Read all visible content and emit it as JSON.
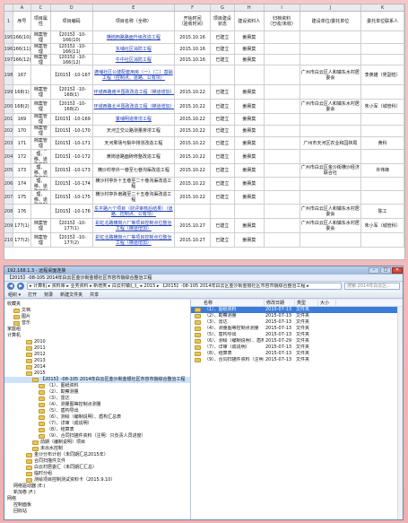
{
  "sheet": {
    "col_letters": [
      "",
      "A",
      "C",
      "D",
      "E",
      "F",
      "G",
      "H",
      "I",
      "J",
      "K"
    ],
    "header": {
      "row_label": "1",
      "no": "序号",
      "type": "项目属性",
      "code": "项目编码",
      "name": "项目名称（全称）",
      "opened": "开始时间",
      "opened_sub": "（验收时间）",
      "status": "项目建设状态",
      "dept": "建设资料人",
      "archive": "归档资料",
      "archive_sub": "（已收/未收）",
      "unit": "建设单位/委托单位",
      "contact": "委托单位联系人"
    },
    "rows": [
      {
        "rn": "195",
        "no": "166(10)",
        "type": "档案管理",
        "code": "【2015】-10-166(10)",
        "name": "横岗西路路面升级改造工程",
        "date": "2015.10.16",
        "status": "已建立",
        "dept": "姜赓莫",
        "unit": "",
        "contact": "",
        "link": true
      },
      {
        "rn": "196",
        "no": "166(11)",
        "type": "档案管理",
        "code": "【2015】-10-166(11)",
        "name": "东埔社区消防工程",
        "date": "2015.10.16",
        "status": "已建立",
        "dept": "姜赓莫",
        "unit": "",
        "contact": "",
        "link": true
      },
      {
        "rn": "197",
        "no": "166(12)",
        "type": "档案管理",
        "code": "【2015】-10-166(12)",
        "name": "牛中社区消防工程",
        "date": "2015.10.16",
        "status": "已建立",
        "dept": "姜赓莫",
        "unit": "",
        "contact": "",
        "link": true
      },
      {
        "rn": "198",
        "no": "167",
        "type": "",
        "code": "【2015】-10-167",
        "name": "德埔社区公建配套用房（一）（二）基础工程（控制点、道路、公有项）",
        "date": "",
        "status": "",
        "dept": "",
        "unit": "广州市白云区人和镇东水村居委会",
        "contact": "李英雄（男副姓）",
        "link": true
      },
      {
        "rn": "199",
        "no": "168(1)",
        "type": "档案管理",
        "code": "【2015】-10-168(1)",
        "name": "环城西路南半围政改造工程（梯道增加）",
        "date": "2015.10.22",
        "status": "已建立",
        "dept": "姜赓莫",
        "unit": "",
        "contact": "",
        "link": true
      },
      {
        "rn": "200",
        "no": "168(2)",
        "type": "档案管理",
        "code": "【2015】-10-168(2)",
        "name": "环城西路北半围政改造工程（梯道增加）",
        "date": "2015.10.22",
        "status": "已建立",
        "dept": "姜赓莫",
        "unit": "广州市白云区人和镇东水村居委会",
        "contact": "朱小军（城管科）",
        "link": true
      },
      {
        "rn": "201",
        "no": "169",
        "type": "档案管理",
        "code": "【2015】-10-169",
        "name": "童埔明道排涝工程",
        "date": "2015.10.22",
        "status": "已建立",
        "dept": "姜赓莫",
        "unit": "",
        "contact": "",
        "link": true
      },
      {
        "rn": "202",
        "no": "170",
        "type": "档案管理",
        "code": "【2015】-10-170",
        "name": "天河立交公路测量排涝工程",
        "date": "2015.10.22",
        "status": "已建立",
        "dept": "姜赓莫",
        "unit": "",
        "contact": "",
        "link": false
      },
      {
        "rn": "203",
        "no": "171",
        "type": "档案管理",
        "code": "【2015】-10-171",
        "name": "天河果场与梨中排涝改造工程",
        "date": "2015.10.22",
        "status": "已建立",
        "dept": "姜赓莫",
        "unit": "广州市天河区农业和园林局",
        "contact": "黄科",
        "link": false
      },
      {
        "rn": "204",
        "no": "172",
        "type": "档案管理、移、道路管制",
        "code": "【2015】-10-172",
        "name": "黄岗道路面砖修整改造工程",
        "date": "2015.10.22",
        "status": "已建立",
        "dept": "姜赓莫",
        "unit": "",
        "contact": "",
        "link": false
      },
      {
        "rn": "205",
        "no": "173",
        "type": "档案管理、移、道路管制",
        "code": "【2015】-10-173",
        "name": "横沙村亭外一巷至七巷沟渠改造工程",
        "date": "2015.10.22",
        "status": "已建立",
        "dept": "姜赓莫",
        "unit": "广州市白云区金沙街横沙经济联合社",
        "contact": "许伟锋",
        "link": false
      },
      {
        "rn": "206",
        "no": "174",
        "type": "档案管理、移、道路管制",
        "code": "【2015】-10-174",
        "name": "横沙村亭外十五巷至二十巷沟渠改造工程",
        "date": "2015.10.22",
        "status": "已建立",
        "dept": "姜赓莫",
        "unit": "",
        "contact": "",
        "link": false
      },
      {
        "rn": "207",
        "no": "175",
        "type": "档案管理、移、道路管制",
        "code": "【2015】-10-175",
        "name": "横沙村亭外南路至二十五巷沟渠改造工程",
        "date": "2015.10.22",
        "status": "已建立",
        "dept": "姜赓莫",
        "unit": "",
        "contact": "",
        "link": false
      },
      {
        "rn": "208",
        "no": "176",
        "type": "",
        "code": "【2015】-10-176",
        "name": "东平路六个项目（财评审核后结果）（道路、控制点、公有项）",
        "date": "",
        "status": "",
        "dept": "",
        "unit": "广州市白云区人和镇东水村居委会",
        "contact": "陈工",
        "link": true
      },
      {
        "rn": "209",
        "no": "177(1)",
        "type": "档案管理",
        "code": "【2015】-10-177(1)",
        "name": "彩虹北路横岗六厂等项目控制点位整治工程（梯道增加）",
        "date": "2015.10.27",
        "status": "已建立",
        "dept": "姜赓莫",
        "unit": "广州市白云区人和镇东水村居委会",
        "contact": "朱小军（城管科）",
        "link": true
      },
      {
        "rn": "210",
        "no": "177(2)",
        "type": "档案管理",
        "code": "【2015】-10-177(2)",
        "name": "彩虹北路横岗六厂等项目控制点位整治工程（梯道增加）",
        "date": "2015.10.27",
        "status": "已建立",
        "dept": "姜赓莫",
        "unit": "",
        "contact": "",
        "link": true
      }
    ]
  },
  "window": {
    "title": "192.168.1.3 - 远程桌面连接",
    "subtitle": "【2015】-08-105 2014年白云区金沙街金银社区市容市貌综合整治工程",
    "controls": [
      "–",
      "□",
      "✕"
    ],
    "path": "▸ 计算机 ▸ 资料库 ▸ 业务资料 ▸ 新增类 ▸ 白云村镇汇汇 ▸ 2015 ▸ 【2015】-08-105 2014年白云区金沙街金银社区市容市貌综合整治工程 ▸",
    "search_placeholder": "搜索 2014年白云区...",
    "toolbar": [
      "组织 ▾",
      "打开",
      "刻录",
      "新建文件夹",
      "共享"
    ],
    "nav": [
      {
        "label": "收藏夹",
        "indent": 0,
        "folder": false
      },
      {
        "label": "文档",
        "indent": 1,
        "folder": true
      },
      {
        "label": "图片",
        "indent": 1,
        "folder": true
      },
      {
        "label": "音乐",
        "indent": 1,
        "folder": true
      },
      {
        "label": "家庭组",
        "indent": 0,
        "folder": false
      },
      {
        "label": "计算机",
        "indent": 0,
        "folder": false
      },
      {
        "label": "2010",
        "indent": 3,
        "folder": true
      },
      {
        "label": "2011",
        "indent": 3,
        "folder": true
      },
      {
        "label": "2012",
        "indent": 3,
        "folder": true
      },
      {
        "label": "2013",
        "indent": 3,
        "folder": true
      },
      {
        "label": "2014",
        "indent": 3,
        "folder": true
      },
      {
        "label": "2015",
        "indent": 3,
        "folder": true
      },
      {
        "label": "【2015】-08-105 2014年白云区金沙街金银社区市容市貌综合整治工程",
        "indent": 4,
        "folder": true,
        "selected": true
      },
      {
        "label": "（1）、图纸资料",
        "indent": 5,
        "folder": true
      },
      {
        "label": "（2）、勘察测量",
        "indent": 5,
        "folder": true
      },
      {
        "label": "（3）、雷达",
        "indent": 5,
        "folder": true
      },
      {
        "label": "（4）、测量图等控制点测量",
        "indent": 5,
        "folder": true
      },
      {
        "label": "（5）、盾构导出",
        "indent": 5,
        "folder": true
      },
      {
        "label": "（6）、测绘（编制说明）、盾构汇总表",
        "indent": 5,
        "folder": true
      },
      {
        "label": "（7）、详审（成说明）",
        "indent": 5,
        "folder": true
      },
      {
        "label": "（8）、结算表",
        "indent": 5,
        "folder": true
      },
      {
        "label": "（9）、合同扫描件资料（注明：只负责人员进度）",
        "indent": 5,
        "folder": true
      },
      {
        "label": "前期（编制说明）项目",
        "indent": 4,
        "folder": true
      },
      {
        "label": "未出水控制",
        "indent": 4,
        "folder": true
      },
      {
        "label": "金沙分布计划（未同期汇总2015年）",
        "indent": 3,
        "folder": true
      },
      {
        "label": "合同扫描件文件",
        "indent": 3,
        "folder": true
      },
      {
        "label": "白云村居委汇（未同期汇汇总）",
        "indent": 3,
        "folder": true
      },
      {
        "label": "临时分组",
        "indent": 3,
        "folder": true
      },
      {
        "label": "测绘项目控制测试资料卡（2015.9.10）",
        "indent": 3,
        "folder": true
      },
      {
        "label": "网络驱动器 (E:)",
        "indent": 1,
        "folder": false
      },
      {
        "label": "新加卷 (F:)",
        "indent": 1,
        "folder": false
      },
      {
        "label": "网络",
        "indent": 0,
        "folder": false
      },
      {
        "label": "控制面板",
        "indent": 1,
        "folder": false
      },
      {
        "label": "回收站",
        "indent": 1,
        "folder": false
      }
    ],
    "columns": [
      "名称",
      "修改日期",
      "类型",
      "大小"
    ],
    "files": [
      {
        "name": "（1）、图纸资料",
        "date": "2015-07-13",
        "type": "文件夹",
        "selected": true
      },
      {
        "name": "（2）、勘察测量",
        "date": "2015-07-13",
        "type": "文件夹"
      },
      {
        "name": "（3）、雷达",
        "date": "2015-07-13",
        "type": "文件夹"
      },
      {
        "name": "（4）、测量图等控制点测量",
        "date": "2015-07-13",
        "type": "文件夹"
      },
      {
        "name": "（5）、盾构导出",
        "date": "2015-07-13",
        "type": "文件夹"
      },
      {
        "name": "（6）、测绘（编制说明）、盾构汇总表",
        "date": "2015-07-29",
        "type": "文件夹"
      },
      {
        "name": "（7）、详审（成说明）",
        "date": "2015-07-13",
        "type": "文件夹"
      },
      {
        "name": "（8）、结算表",
        "date": "2015-07-13",
        "type": "文件夹"
      },
      {
        "name": "（9）、合同扫描件资料（注明：只负责...",
        "date": "2015-07-13",
        "type": "文件夹"
      }
    ]
  }
}
